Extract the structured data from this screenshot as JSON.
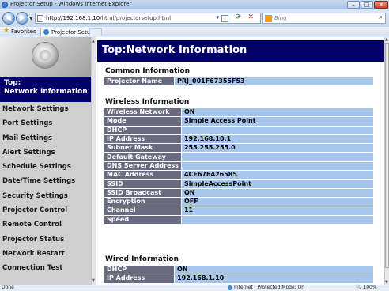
{
  "window": {
    "title": "Projector Setup - Windows Internet Explorer",
    "controls": {
      "minimize": "–",
      "maximize": "□",
      "close": "✕"
    }
  },
  "address_bar": {
    "url_host": "http://192.168.1.10",
    "url_path": "/html/projectorsetup.html",
    "search_placeholder": "Bing"
  },
  "favorites_bar": {
    "favorites_label": "Favorites",
    "tab_label": "Projector Setup"
  },
  "sidebar": {
    "top_label": "Top:\nNetwork Information",
    "items": [
      {
        "label": "Network Settings"
      },
      {
        "label": "Port Settings"
      },
      {
        "label": "Mail Settings"
      },
      {
        "label": "Alert Settings"
      },
      {
        "label": "Schedule Settings"
      },
      {
        "label": "Date/Time Settings"
      },
      {
        "label": "Security Settings"
      },
      {
        "label": "Projector Control"
      },
      {
        "label": "Remote Control"
      },
      {
        "label": "Projector Status"
      },
      {
        "label": "Network Restart"
      },
      {
        "label": "Connection Test"
      }
    ]
  },
  "main": {
    "title": "Top:Network Information",
    "common": {
      "heading": "Common Information",
      "rows": [
        {
          "key": "Projector Name",
          "value": "PRJ_001F67355F53"
        }
      ]
    },
    "wireless": {
      "heading": "Wireless Information",
      "rows": [
        {
          "key": "Wireless Network",
          "value": "ON"
        },
        {
          "key": "Mode",
          "value": "Simple Access Point"
        },
        {
          "key": "DHCP",
          "value": ""
        },
        {
          "key": "IP Address",
          "value": "192.168.10.1"
        },
        {
          "key": "Subnet Mask",
          "value": "255.255.255.0"
        },
        {
          "key": "Default Gateway",
          "value": ""
        },
        {
          "key": "DNS Server Address",
          "value": ""
        },
        {
          "key": "MAC Address",
          "value": "4CE676426585"
        },
        {
          "key": "SSID",
          "value": "SimpleAccessPoint"
        },
        {
          "key": "SSID Broadcast",
          "value": "ON"
        },
        {
          "key": "Encryption",
          "value": "OFF"
        },
        {
          "key": "Channel",
          "value": "11"
        },
        {
          "key": "Speed",
          "value": ""
        }
      ]
    },
    "wired": {
      "heading": "Wired Information",
      "rows": [
        {
          "key": "DHCP",
          "value": "ON"
        },
        {
          "key": "IP Address",
          "value": "192.168.1.10"
        }
      ]
    }
  },
  "status_bar": {
    "status": "Done",
    "zone": "Internet | Protected Mode: On",
    "zoom": "100%"
  },
  "colors": {
    "nav_dark": "#000066",
    "key_cell": "#6a6a80",
    "value_cell": "#a6c6ec",
    "sidebar_bg": "#cfcfcf"
  }
}
